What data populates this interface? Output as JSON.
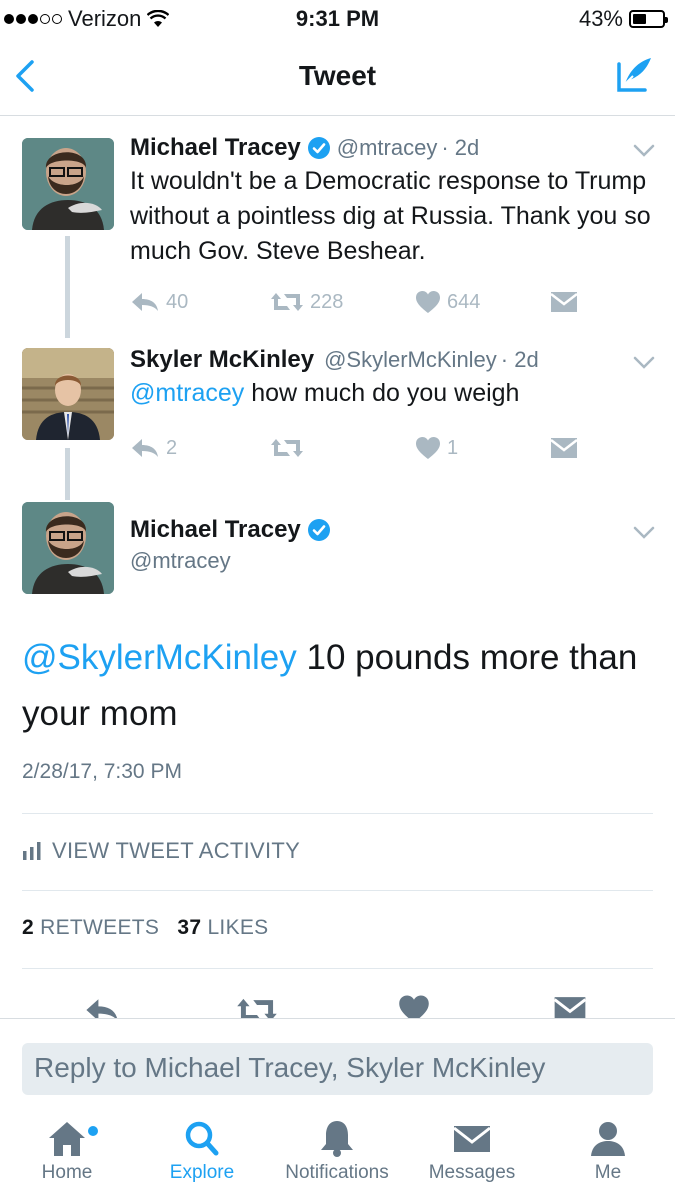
{
  "status_bar": {
    "carrier": "Verizon",
    "time": "9:31 PM",
    "battery": "43%"
  },
  "nav": {
    "title": "Tweet"
  },
  "thread": [
    {
      "name": "Michael Tracey",
      "handle": "@mtracey",
      "time": "· 2d",
      "text": "It wouldn't be a Democratic response to Trump without a pointless dig at Russia. Thank you so much Gov. Steve Beshear.",
      "replies": "40",
      "retweets": "228",
      "likes": "644"
    },
    {
      "name": "Skyler McKinley",
      "handle": "@SkylerMcKinley",
      "time": "· 2d",
      "mention": "@mtracey",
      "text": " how much do you weigh",
      "replies": "2",
      "retweets": "",
      "likes": "1"
    }
  ],
  "main_tweet": {
    "name": "Michael Tracey",
    "handle": "@mtracey",
    "mention": "@SkylerMcKinley",
    "text": " 10 pounds more than your mom",
    "timestamp": "2/28/17, 7:30 PM",
    "activity_label": "VIEW TWEET ACTIVITY",
    "retweets_count": "2",
    "retweets_label": "RETWEETS",
    "likes_count": "37",
    "likes_label": "LIKES"
  },
  "reply": {
    "placeholder": "Reply to Michael Tracey, Skyler McKinley"
  },
  "tabs": [
    {
      "label": "Home",
      "icon": "home-icon"
    },
    {
      "label": "Explore",
      "icon": "search-icon"
    },
    {
      "label": "Notifications",
      "icon": "bell-icon"
    },
    {
      "label": "Messages",
      "icon": "envelope-icon"
    },
    {
      "label": "Me",
      "icon": "person-icon"
    }
  ],
  "colors": {
    "accent": "#1da1f2",
    "muted": "#657786",
    "icon_gray": "#aab8c2"
  }
}
